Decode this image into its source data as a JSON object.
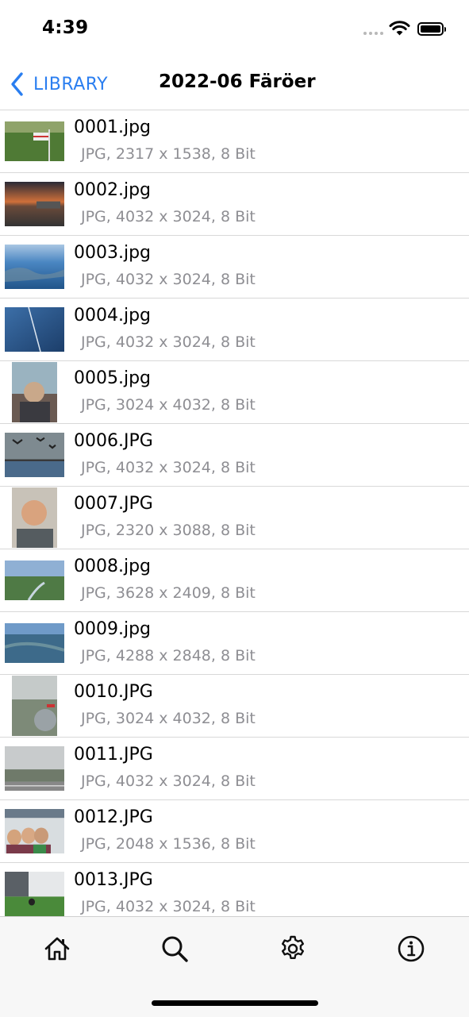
{
  "status_bar": {
    "time": "4:39"
  },
  "nav": {
    "back_label": "LIBRARY",
    "title": "2022-06 Fäöer"
  },
  "files": [
    {
      "name": "0001.jpg",
      "meta": "JPG, 2317 x 1538, 8 Bit"
    },
    {
      "name": "0002.jpg",
      "meta": "JPG, 4032 x 3024, 8 Bit"
    },
    {
      "name": "0003.jpg",
      "meta": "JPG, 4032 x 3024, 8 Bit"
    },
    {
      "name": "0004.jpg",
      "meta": "JPG, 4032 x 3024, 8 Bit"
    },
    {
      "name": "0005.jpg",
      "meta": "JPG, 3024 x 4032, 8 Bit"
    },
    {
      "name": "0006.JPG",
      "meta": "JPG, 4032 x 3024, 8 Bit"
    },
    {
      "name": "0007.JPG",
      "meta": "JPG, 2320 x 3088, 8 Bit"
    },
    {
      "name": "0008.jpg",
      "meta": "JPG, 3628 x 2409, 8 Bit"
    },
    {
      "name": "0009.jpg",
      "meta": "JPG, 4288 x 2848, 8 Bit"
    },
    {
      "name": "0010.JPG",
      "meta": "JPG, 3024 x 4032, 8 Bit"
    },
    {
      "name": "0011.JPG",
      "meta": "JPG, 4032 x 3024, 8 Bit"
    },
    {
      "name": "0012.JPG",
      "meta": "JPG, 2048 x 1536, 8 Bit"
    },
    {
      "name": "0013.JPG",
      "meta": "JPG, 4032 x 3024, 8 Bit"
    }
  ],
  "tab_bar": {
    "icons": [
      "home-icon",
      "search-icon",
      "gear-icon",
      "info-icon"
    ]
  },
  "colors": {
    "accent": "#2a7ef0",
    "secondary_text": "#8e8e93"
  }
}
